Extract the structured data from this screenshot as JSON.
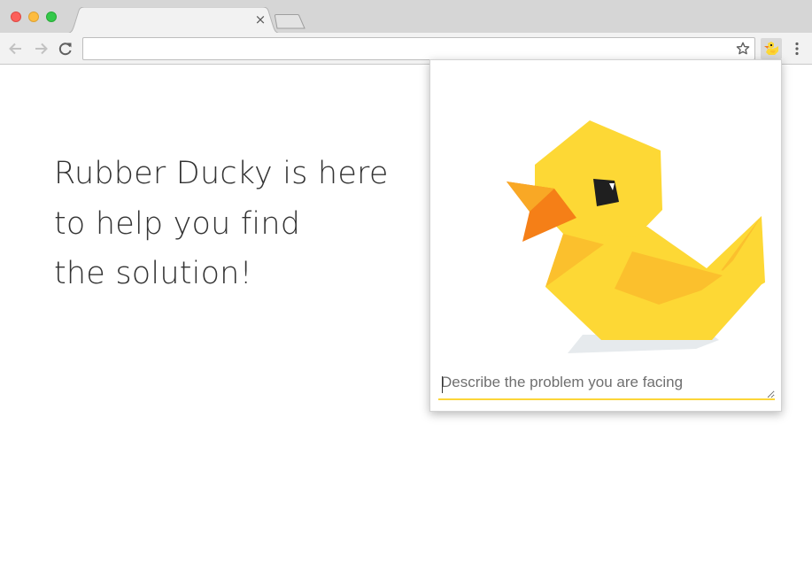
{
  "browser": {
    "tab": {
      "title": "",
      "close_glyph": "×"
    },
    "toolbar": {
      "back_icon": "arrow-left-icon",
      "forward_icon": "arrow-right-icon",
      "reload_icon": "reload-icon",
      "address": {
        "value": "",
        "placeholder": ""
      },
      "bookmark_icon": "star-icon",
      "extension_icon": "rubber-duck-icon",
      "menu_icon": "vertical-dots-icon"
    }
  },
  "page": {
    "headline_lines": [
      "Rubber Ducky is here",
      "to help you find",
      "the solution!"
    ]
  },
  "popup": {
    "illustration": "rubber-duck-icon",
    "problem_input": {
      "value": "",
      "placeholder": "Describe the problem you are facing"
    },
    "colors": {
      "accent": "#fcd539",
      "duck_body": "#fdd835",
      "duck_shade": "#fbc02d",
      "beak": "#f57f17"
    }
  }
}
